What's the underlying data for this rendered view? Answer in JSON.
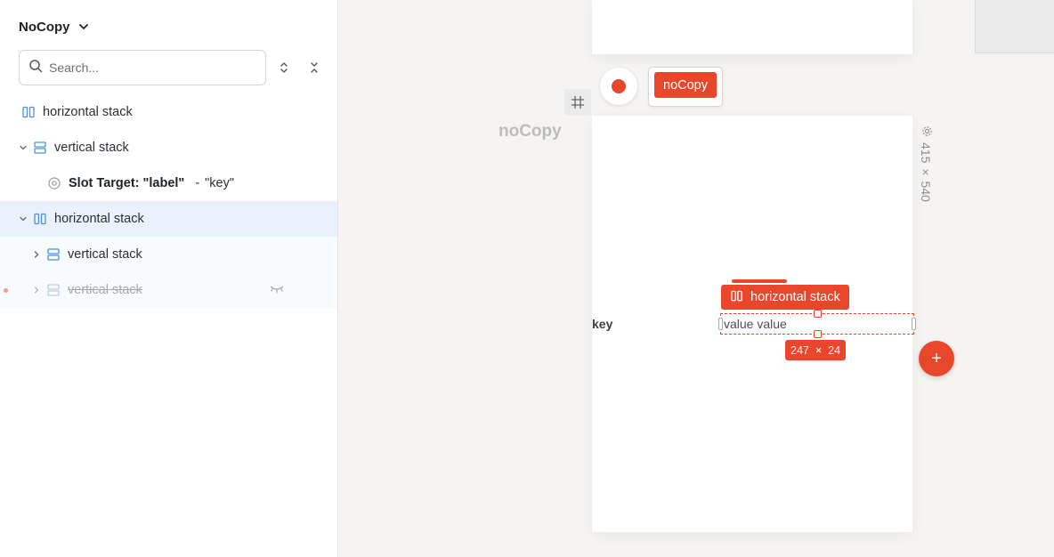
{
  "sidebar": {
    "title": "NoCopy",
    "search": {
      "placeholder": "Search..."
    },
    "tree": [
      {
        "label": "horizontal stack",
        "icon": "horizontal-stack-icon",
        "expanded": null
      },
      {
        "label": "vertical stack",
        "icon": "vertical-stack-icon",
        "expanded": true
      },
      {
        "slot_bold": "Slot Target: \"label\"",
        "slot_sep": "-",
        "slot_value": "\"key\"",
        "icon": "slot-target-icon"
      },
      {
        "label": "horizontal stack",
        "icon": "horizontal-stack-icon",
        "expanded": true,
        "selected": true
      },
      {
        "label": "vertical stack",
        "icon": "vertical-stack-icon",
        "expanded": false
      },
      {
        "label": "vertical stack",
        "icon": "vertical-stack-icon",
        "expanded": false,
        "hidden": true
      }
    ]
  },
  "canvas": {
    "chip_label": "noCopy",
    "frame_name": "noCopy",
    "frame_dims": {
      "width": "415",
      "sep": "×",
      "height": "540"
    },
    "key_label": "key",
    "selection": {
      "tag_label": "horizontal stack",
      "text": "value value",
      "width": "247",
      "sep": "×",
      "height": "24"
    },
    "add_label": "+"
  },
  "colors": {
    "accent": "#e8472b",
    "selection_bg": "#e9f2fc",
    "icon_blue": "#4a90d9"
  }
}
